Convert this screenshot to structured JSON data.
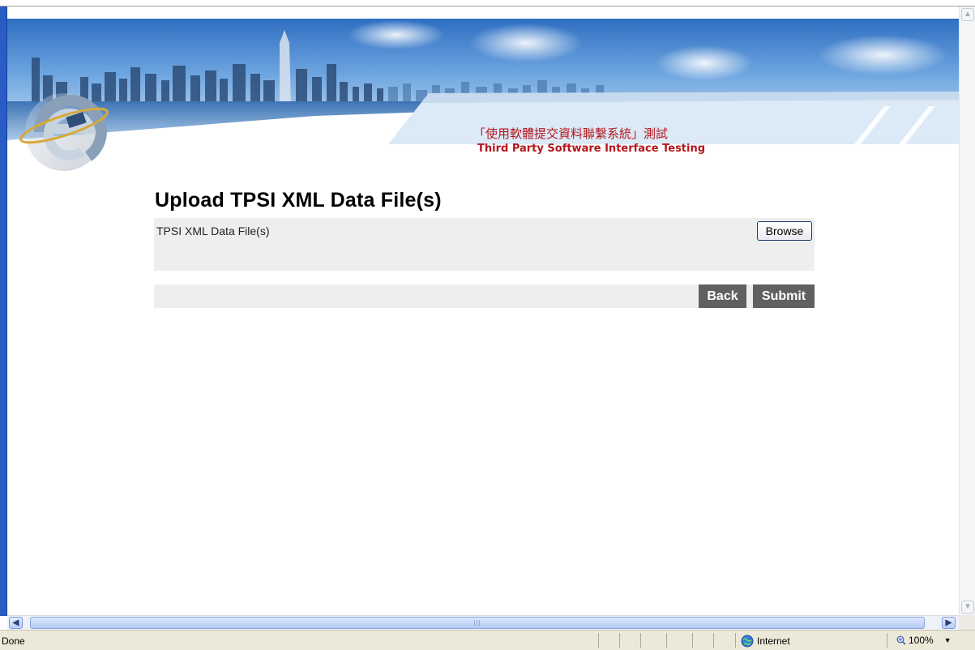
{
  "banner": {
    "title_cn": "「使用軟體提交資料聯繫系統」測試",
    "title_en": "Third Party Software Interface Testing"
  },
  "page": {
    "heading": "Upload TPSI XML Data File(s)",
    "file_field_label": "TPSI XML Data File(s)",
    "browse_label": "Browse",
    "back_label": "Back",
    "submit_label": "Submit"
  },
  "statusbar": {
    "status_text": "Done",
    "zone_text": "Internet",
    "zoom_text": "100%"
  },
  "colors": {
    "banner_red": "#b5161c",
    "panel_bg": "#eeeeee",
    "button_dark": "#606060",
    "window_blue": "#2a5cc8"
  }
}
